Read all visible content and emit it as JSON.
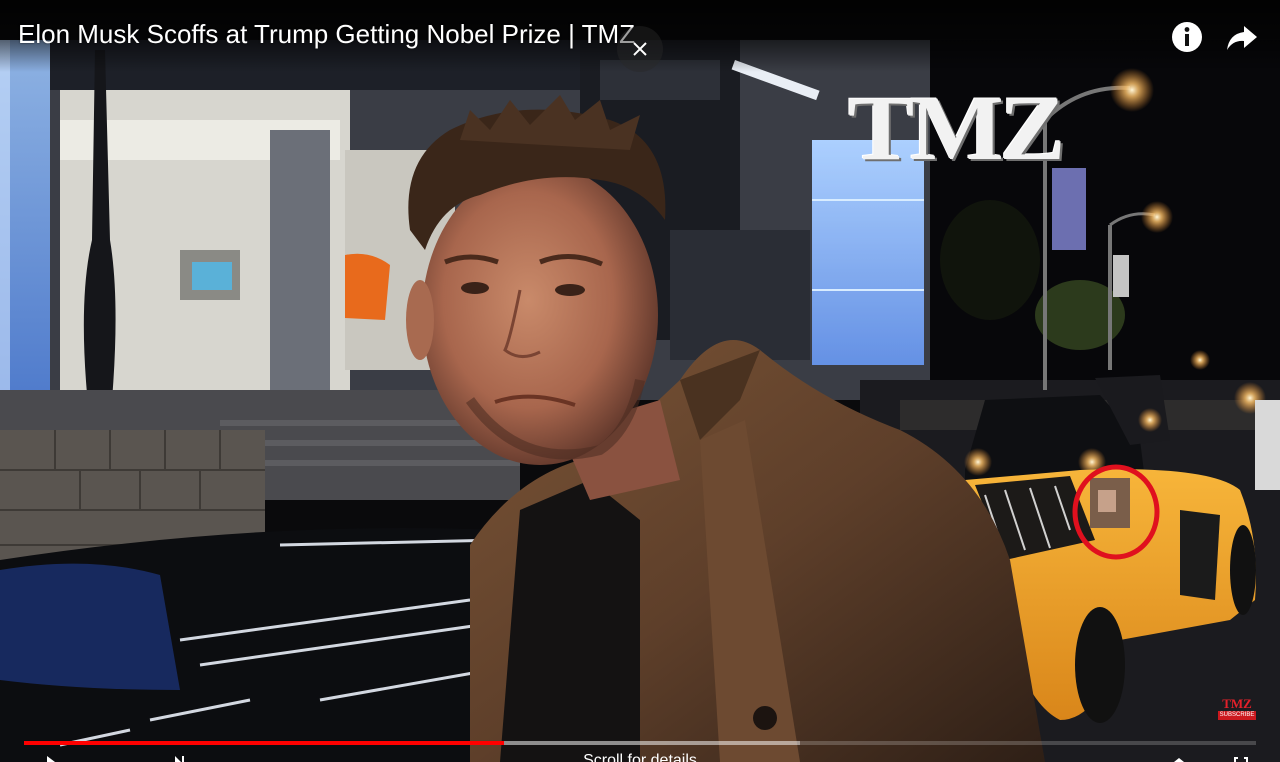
{
  "video": {
    "title": "Elon Musk Scoffs at Trump Getting Nobel Prize | TMZ",
    "overlay_logo": "TMZ",
    "progress_played": 0.39,
    "progress_buffered": 0.63
  },
  "watermark": {
    "logo": "TMZ",
    "subscribe": "SUBSCRIBE"
  },
  "controls": {
    "scroll_hint": "Scroll for details"
  },
  "icons": {
    "close": "close-icon",
    "info": "info-icon",
    "share": "share-icon"
  },
  "colors": {
    "progress": "#ff0000",
    "highlight_circle": "#e0101e",
    "car": "#f3a21f"
  }
}
